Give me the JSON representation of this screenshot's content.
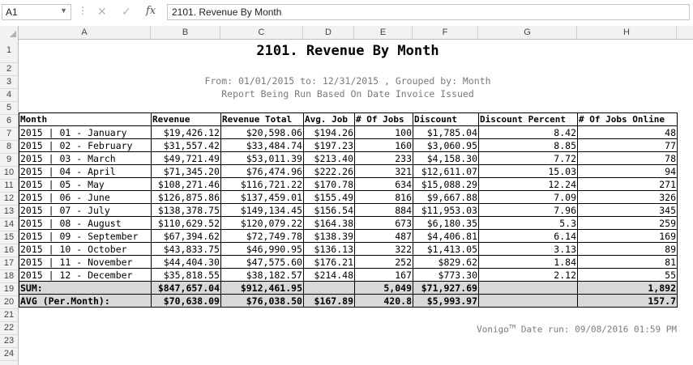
{
  "formula_bar": {
    "cell_ref": "A1",
    "formula": "2101. Revenue By Month"
  },
  "columns": [
    "A",
    "B",
    "C",
    "D",
    "E",
    "F",
    "G",
    "H"
  ],
  "rows": [
    "1",
    "2",
    "3",
    "4",
    "5",
    "6",
    "7",
    "8",
    "9",
    "10",
    "11",
    "12",
    "13",
    "14",
    "15",
    "16",
    "17",
    "18",
    "19",
    "20",
    "21",
    "22",
    "23",
    "24"
  ],
  "report": {
    "title": "2101. Revenue By Month",
    "subtitle1": "From: 01/01/2015 to: 12/31/2015 , Grouped by: Month",
    "subtitle2": "Report Being Run Based On Date Invoice Issued",
    "headers": [
      "Month",
      "Revenue",
      "Revenue Total",
      "Avg. Job",
      "# Of Jobs",
      "Discount",
      "Discount Percent",
      "# Of Jobs Online"
    ],
    "data": [
      [
        "2015 | 01 - January",
        "$19,426.12",
        "$20,598.06",
        "$194.26",
        "100",
        "$1,785.04",
        "8.42",
        "48"
      ],
      [
        "2015 | 02 - February",
        "$31,557.42",
        "$33,484.74",
        "$197.23",
        "160",
        "$3,060.95",
        "8.85",
        "77"
      ],
      [
        "2015 | 03 - March",
        "$49,721.49",
        "$53,011.39",
        "$213.40",
        "233",
        "$4,158.30",
        "7.72",
        "78"
      ],
      [
        "2015 | 04 - April",
        "$71,345.20",
        "$76,474.96",
        "$222.26",
        "321",
        "$12,611.07",
        "15.03",
        "94"
      ],
      [
        "2015 | 05 - May",
        "$108,271.46",
        "$116,721.22",
        "$170.78",
        "634",
        "$15,088.29",
        "12.24",
        "271"
      ],
      [
        "2015 | 06 - June",
        "$126,875.86",
        "$137,459.01",
        "$155.49",
        "816",
        "$9,667.88",
        "7.09",
        "326"
      ],
      [
        "2015 | 07 - July",
        "$138,378.75",
        "$149,134.45",
        "$156.54",
        "884",
        "$11,953.03",
        "7.96",
        "345"
      ],
      [
        "2015 | 08 - August",
        "$110,629.52",
        "$120,079.22",
        "$164.38",
        "673",
        "$6,180.35",
        "5.3",
        "259"
      ],
      [
        "2015 | 09 - September",
        "$67,394.62",
        "$72,749.78",
        "$138.39",
        "487",
        "$4,406.81",
        "6.14",
        "169"
      ],
      [
        "2015 | 10 - October",
        "$43,833.75",
        "$46,990.95",
        "$136.13",
        "322",
        "$1,413.05",
        "3.13",
        "89"
      ],
      [
        "2015 | 11 - November",
        "$44,404.30",
        "$47,575.60",
        "$176.21",
        "252",
        "$829.62",
        "1.84",
        "81"
      ],
      [
        "2015 | 12 - December",
        "$35,818.55",
        "$38,182.57",
        "$214.48",
        "167",
        "$773.30",
        "2.12",
        "55"
      ]
    ],
    "sum_row": [
      "SUM:",
      "$847,657.04",
      "$912,461.95",
      "",
      "5,049",
      "$71,927.69",
      "",
      "1,892"
    ],
    "avg_row": [
      "AVG (Per.Month):",
      "$70,638.09",
      "$76,038.50",
      "$167.89",
      "420.8",
      "$5,993.97",
      "",
      "157.7"
    ],
    "footer_brand": "Vonigo",
    "footer_tm": "TM",
    "footer_date": " Date run: 09/08/2016 01:59 PM"
  }
}
